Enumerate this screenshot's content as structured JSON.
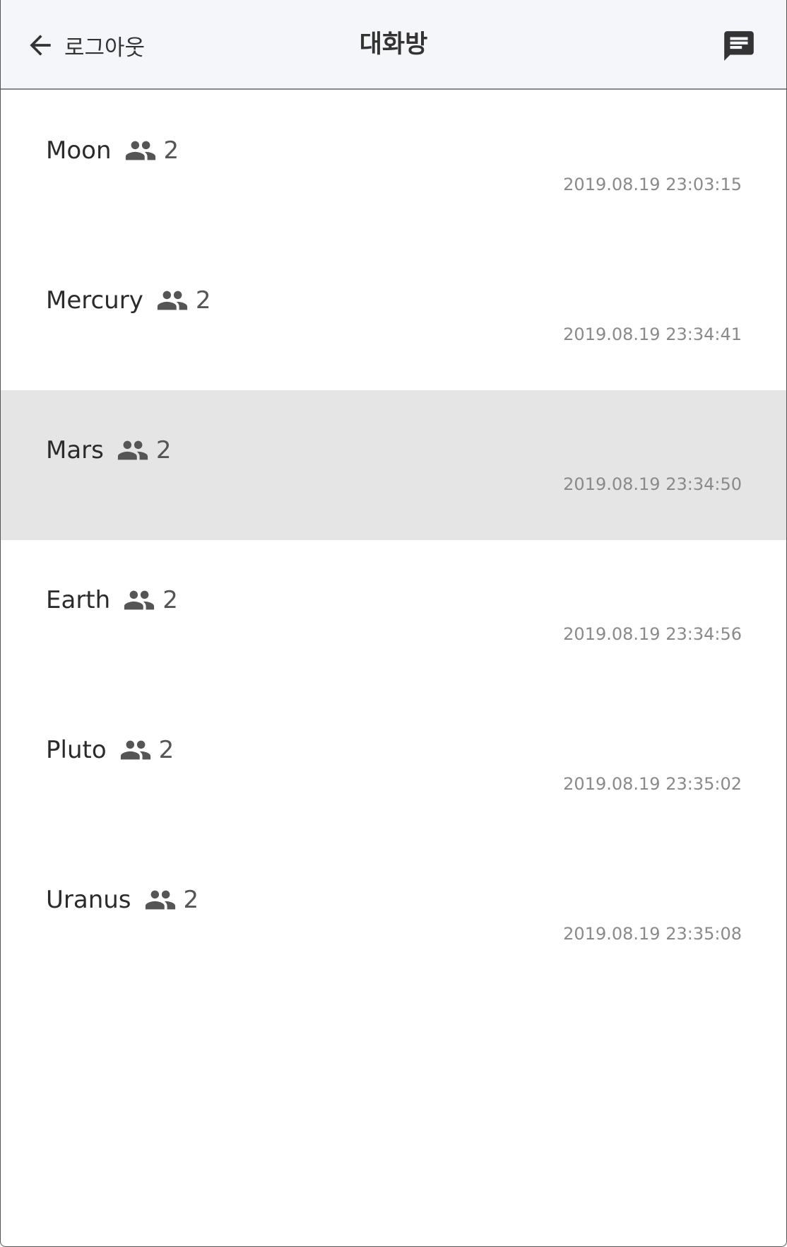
{
  "header": {
    "back_label": "로그아웃",
    "title": "대화방"
  },
  "rooms": [
    {
      "name": "Moon",
      "count": "2",
      "time": "2019.08.19 23:03:15",
      "selected": false
    },
    {
      "name": "Mercury",
      "count": "2",
      "time": "2019.08.19 23:34:41",
      "selected": false
    },
    {
      "name": "Mars",
      "count": "2",
      "time": "2019.08.19 23:34:50",
      "selected": true
    },
    {
      "name": "Earth",
      "count": "2",
      "time": "2019.08.19 23:34:56",
      "selected": false
    },
    {
      "name": "Pluto",
      "count": "2",
      "time": "2019.08.19 23:35:02",
      "selected": false
    },
    {
      "name": "Uranus",
      "count": "2",
      "time": "2019.08.19 23:35:08",
      "selected": false
    }
  ],
  "colors": {
    "header_bg": "#f5f6fa",
    "selected_row_bg": "#e5e5e5",
    "icon": "#555555",
    "timestamp": "#8a8a8a"
  },
  "icons": {
    "back": "arrow-back-icon",
    "chat": "chat-icon",
    "people": "people-icon"
  }
}
